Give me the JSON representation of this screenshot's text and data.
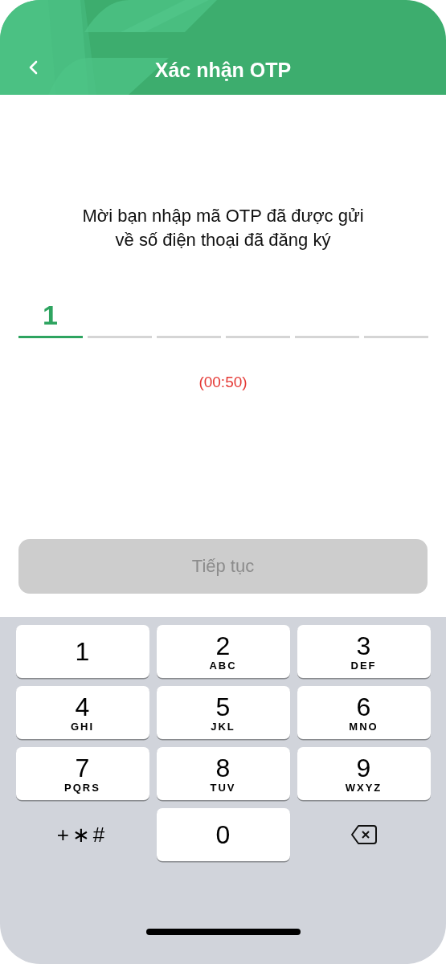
{
  "header": {
    "title": "Xác nhận OTP"
  },
  "instruction_lines": [
    "Mời bạn nhập mã OTP đã được gửi",
    "về số điện thoại đã đăng ký"
  ],
  "otp_slots": [
    {
      "value": "1",
      "selected": true
    },
    {
      "selected": false
    },
    {
      "selected": false
    },
    {
      "selected": false
    },
    {
      "selected": false
    },
    {
      "selected": false
    }
  ],
  "timer": "(00:50)",
  "continue_button": {
    "label": "Tiếp tục",
    "disabled": true
  },
  "keypad": [
    {
      "kind": "digit",
      "digit": "1"
    },
    {
      "kind": "digit",
      "digit": "2",
      "letters": "ABC"
    },
    {
      "kind": "digit",
      "digit": "3",
      "letters": "DEF"
    },
    {
      "kind": "digit",
      "digit": "4",
      "letters": "GHI"
    },
    {
      "kind": "digit",
      "digit": "5",
      "letters": "JKL"
    },
    {
      "kind": "digit",
      "digit": "6",
      "letters": "MNO"
    },
    {
      "kind": "digit",
      "digit": "7",
      "letters": "PQRS"
    },
    {
      "kind": "digit",
      "digit": "8",
      "letters": "TUV"
    },
    {
      "kind": "digit",
      "digit": "9",
      "letters": "WXYZ"
    },
    {
      "kind": "symbols",
      "digit": "+∗#"
    },
    {
      "kind": "digit",
      "digit": "0"
    },
    {
      "kind": "backspace"
    }
  ]
}
